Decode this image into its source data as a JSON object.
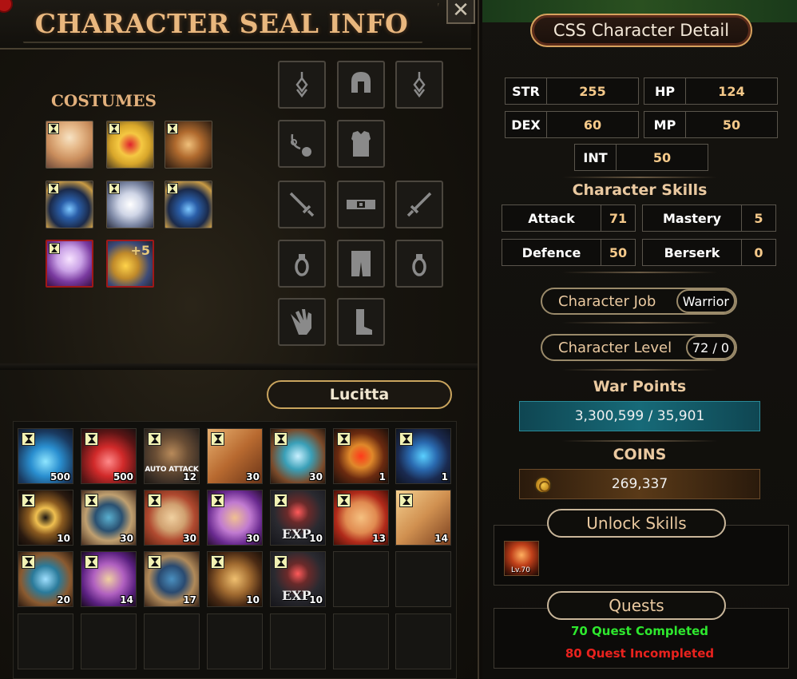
{
  "left_panel": {
    "title": "CHARACTER SEAL INFO",
    "close_label": "✕",
    "costumes_label": "COSTUMES",
    "costumes": [
      {
        "name": "fairy-costume"
      },
      {
        "name": "golden-armor-costume"
      },
      {
        "name": "ornate-emblem-costume"
      },
      {
        "name": "blue-gauntlet-costume"
      },
      {
        "name": "silver-wings-costume"
      },
      {
        "name": "blue-gauntlet-costume"
      },
      {
        "name": "purple-angel-costume"
      },
      {
        "name": "medal-costume",
        "plus": "+5"
      }
    ],
    "equipment_slots": [
      "earring-left",
      "helmet",
      "earring-right",
      "necklace",
      "armor",
      "weapon-left",
      "belt",
      "weapon-right",
      "ring-left",
      "pants",
      "ring-right",
      "gloves",
      "boots"
    ],
    "character_name": "Lucitta",
    "inventory": [
      {
        "icon": "blue-potion",
        "count": "500",
        "timed": true
      },
      {
        "icon": "red-potion",
        "count": "500",
        "timed": true
      },
      {
        "icon": "auto-attack-voucher",
        "count": "12",
        "timed": true,
        "label": "AUTO ATTACK"
      },
      {
        "icon": "crossed-swords-scroll",
        "count": "30",
        "timed": true
      },
      {
        "icon": "green-scroll",
        "count": "30",
        "timed": true
      },
      {
        "icon": "red-star",
        "count": "1",
        "timed": true
      },
      {
        "icon": "blue-star",
        "count": "1",
        "timed": true
      },
      {
        "icon": "golden-ring",
        "count": "10",
        "timed": true
      },
      {
        "icon": "blue-shield-scroll",
        "count": "30",
        "timed": true
      },
      {
        "icon": "red-rune-scroll",
        "count": "30",
        "timed": true
      },
      {
        "icon": "purple-beast-scroll",
        "count": "30",
        "timed": true
      },
      {
        "icon": "exp-scroll",
        "count": "10",
        "timed": true,
        "label": "EXP"
      },
      {
        "icon": "red-rune-scroll",
        "count": "13",
        "timed": true
      },
      {
        "icon": "crossed-swords-scroll",
        "count": "14",
        "timed": true
      },
      {
        "icon": "green-scroll",
        "count": "20",
        "timed": true
      },
      {
        "icon": "purple-beast-scroll",
        "count": "14",
        "timed": true
      },
      {
        "icon": "blue-shield-scroll",
        "count": "17",
        "timed": true
      },
      {
        "icon": "golden-sword",
        "count": "10",
        "timed": true
      },
      {
        "icon": "exp-scroll",
        "count": "10",
        "timed": true,
        "label": "EXP"
      }
    ]
  },
  "right_panel": {
    "title": "CSS Character Detail",
    "stats": {
      "str_label": "STR",
      "str": "255",
      "hp_label": "HP",
      "hp": "124",
      "dex_label": "DEX",
      "dex": "60",
      "mp_label": "MP",
      "mp": "50",
      "int_label": "INT",
      "int": "50"
    },
    "skills_title": "Character Skills",
    "skills": {
      "attack_label": "Attack",
      "attack": "71",
      "mastery_label": "Mastery",
      "mastery": "5",
      "defence_label": "Defence",
      "defence": "50",
      "berserk_label": "Berserk",
      "berserk": "0"
    },
    "job_label": "Character Job",
    "job": "Warrior",
    "level_label": "Character Level",
    "level": "72 / 0",
    "war_points_label": "War Points",
    "war_points": "3,300,599 / 35,901",
    "coins_label": "COINS",
    "coins": "269,337",
    "unlock_skills_label": "Unlock Skills",
    "unlocked_skill_level": "Lv.70",
    "quests_label": "Quests",
    "quests_completed": "70 Quest Completed",
    "quests_incompleted": "80 Quest Incompleted"
  },
  "colors": {
    "title_orange": "#e9b77e",
    "quest_green": "#2ee82e",
    "quest_red": "#e8221e",
    "war_points_teal": "#176a78"
  }
}
